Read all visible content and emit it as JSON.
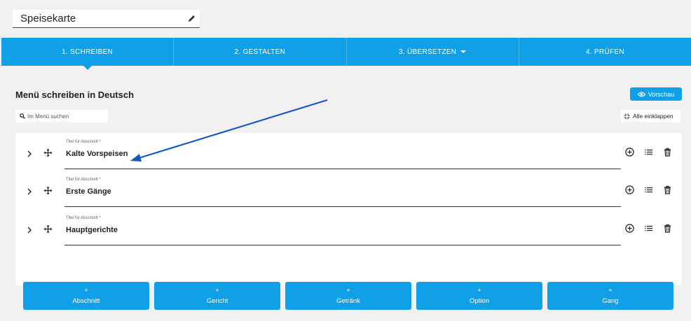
{
  "menu_title": "Speisekarte",
  "tabs": [
    {
      "label": "1. SCHREIBEN",
      "active": true
    },
    {
      "label": "2. GESTALTEN"
    },
    {
      "label": "3. ÜBERSETZEN",
      "has_dropdown": true
    },
    {
      "label": "4. PRÜFEN"
    }
  ],
  "main": {
    "heading": "Menü schreiben in Deutsch",
    "preview_label": "Vorschau",
    "search_placeholder": "Im Menü suchen",
    "collapse_label": "Alle einklappen"
  },
  "sections": [
    {
      "field_label": "Titel für Abschnitt *",
      "value": "Kalte Vorspeisen"
    },
    {
      "field_label": "Titel für Abschnitt *",
      "value": "Erste Gänge"
    },
    {
      "field_label": "Titel für Abschnitt *",
      "value": "Hauptgerichte"
    }
  ],
  "add_buttons": [
    {
      "plus": "+",
      "label": "Abschnitt"
    },
    {
      "plus": "+",
      "label": "Gericht"
    },
    {
      "plus": "+",
      "label": "Getränk"
    },
    {
      "plus": "+",
      "label": "Option"
    },
    {
      "plus": "+",
      "label": "Gang"
    }
  ],
  "colors": {
    "accent": "#0fa0e8",
    "annotation_arrow": "#1357c9"
  },
  "icons": [
    "pencil-icon",
    "eye-icon",
    "search-icon",
    "collapse-icon",
    "chevron-right-icon",
    "move-icon",
    "add-circle-icon",
    "list-icon",
    "trash-icon"
  ]
}
